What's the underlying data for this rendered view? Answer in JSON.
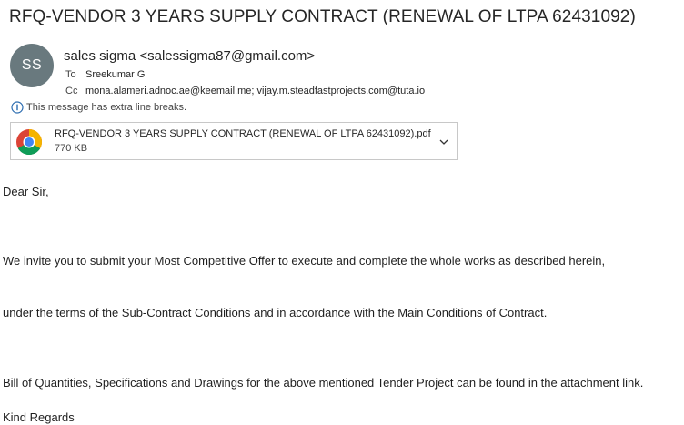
{
  "message": {
    "subject": "RFQ-VENDOR 3 YEARS SUPPLY CONTRACT (RENEWAL OF LTPA 62431092)",
    "avatar_initials": "SS",
    "avatar_color": "#69797e",
    "sender": "sales sigma <salessigma87@gmail.com>",
    "to_label": "To",
    "to_value": "Sreekumar G",
    "cc_label": "Cc",
    "cc_value": "mona.alameri.adnoc.ae@keemail.me; vijay.m.steadfastprojects.com@tuta.io",
    "notice": "This message has extra line breaks."
  },
  "attachment": {
    "icon": "chrome-icon",
    "name": "RFQ-VENDOR 3 YEARS SUPPLY CONTRACT (RENEWAL OF LTPA 62431092).pdf",
    "size": "770 KB"
  },
  "body": {
    "greeting": "Dear Sir,",
    "line1": "We invite you to submit your Most Competitive Offer to execute and complete the whole works as described herein,",
    "line2": "under the terms of the Sub-Contract Conditions and in accordance with the Main Conditions of Contract.",
    "line3": "Bill of Quantities, Specifications and Drawings for the above mentioned Tender Project can be found in the attachment link.",
    "closing": "Kind Regards"
  }
}
